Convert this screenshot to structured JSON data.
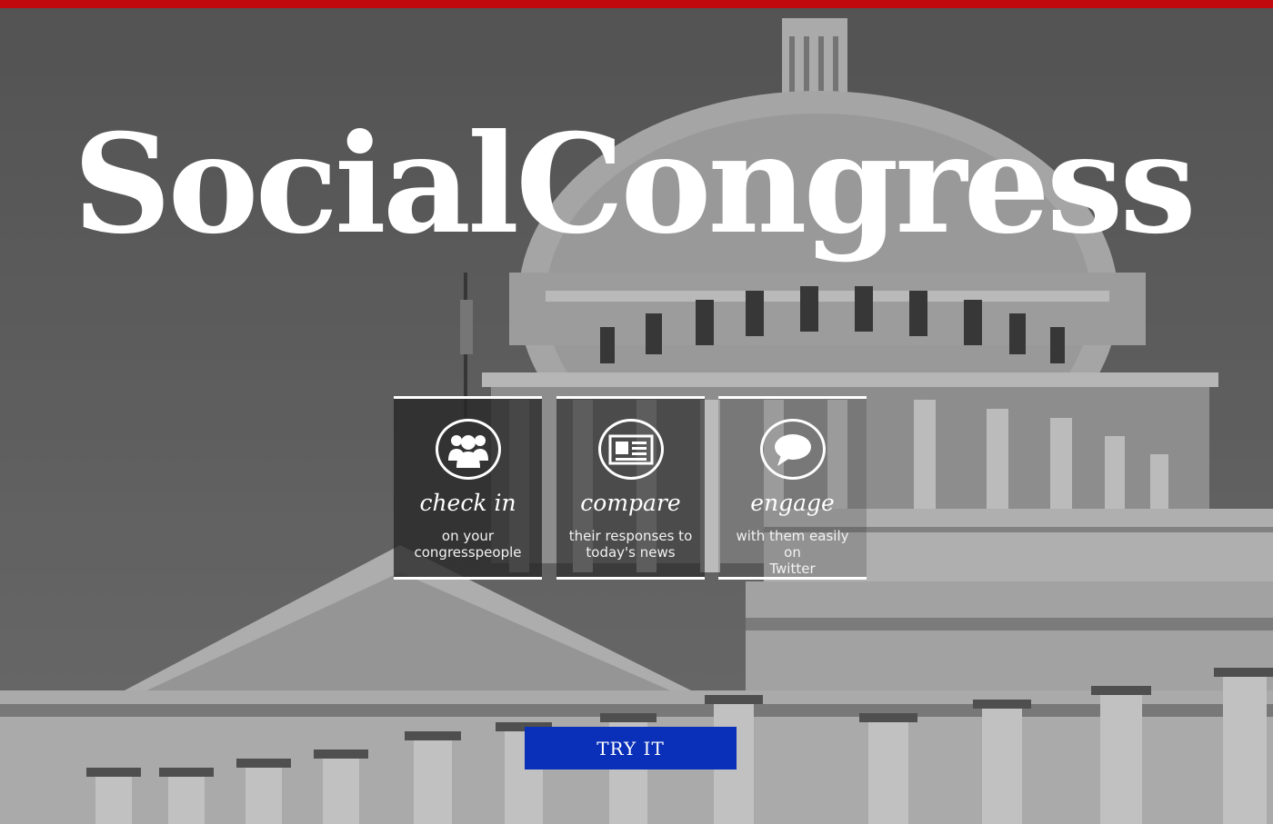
{
  "site": {
    "title": "SocialCongress"
  },
  "colors": {
    "top_bar": "#c0090f",
    "button": "#0a2fb8",
    "text": "#ffffff"
  },
  "background": {
    "image_name": "capitol-building-photo"
  },
  "features": [
    {
      "icon": "group-icon",
      "heading": "check in",
      "line1": "on your",
      "line2": "congresspeople"
    },
    {
      "icon": "newspaper-icon",
      "heading": "compare",
      "line1": "their responses to",
      "line2": "today's news"
    },
    {
      "icon": "speech-bubble-icon",
      "heading": "engage",
      "line1": "with them easily on",
      "line2": "Twitter"
    }
  ],
  "cta": {
    "label": "TRY IT"
  }
}
